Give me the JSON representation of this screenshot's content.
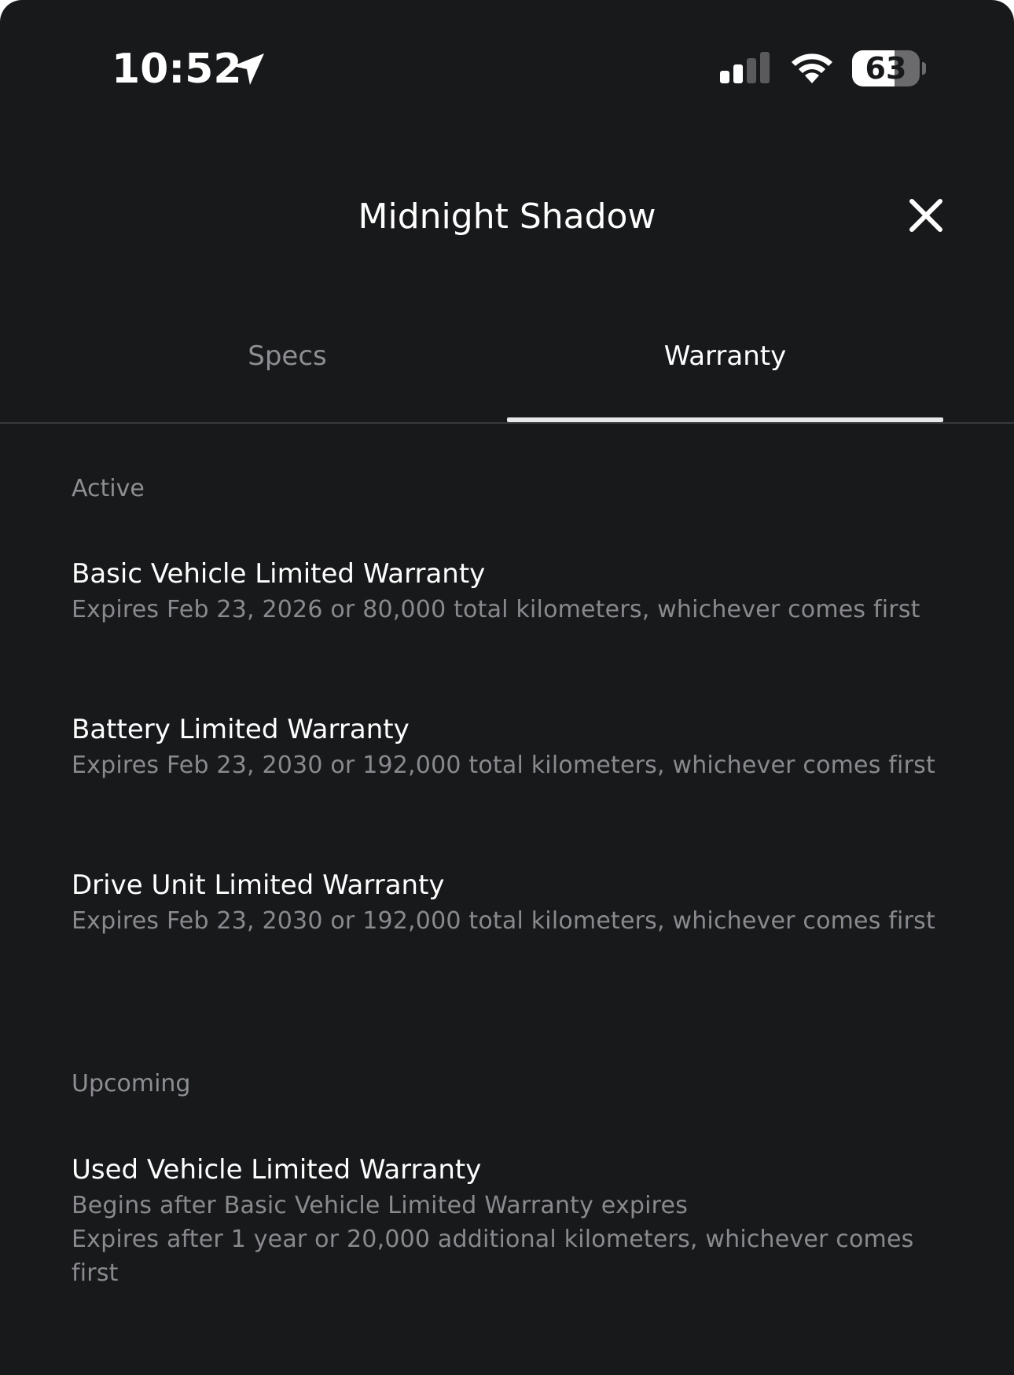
{
  "status_bar": {
    "time": "10:52",
    "battery_level": "63",
    "battery_fraction": 0.63
  },
  "header": {
    "title": "Midnight Shadow",
    "close_icon": "close-icon"
  },
  "tabs": [
    {
      "label": "Specs",
      "selected": false
    },
    {
      "label": "Warranty",
      "selected": true
    }
  ],
  "sections": {
    "active": {
      "label": "Active",
      "items": [
        {
          "name": "Basic Vehicle Limited Warranty",
          "detail": "Expires Feb 23, 2026 or 80,000 total kilometers, whichever comes first"
        },
        {
          "name": "Battery Limited Warranty",
          "detail": "Expires Feb 23, 2030 or 192,000 total kilometers, whichever comes first"
        },
        {
          "name": "Drive Unit Limited Warranty",
          "detail": "Expires Feb 23, 2030 or 192,000 total kilometers, whichever comes first"
        }
      ]
    },
    "upcoming": {
      "label": "Upcoming",
      "items": [
        {
          "name": "Used Vehicle Limited Warranty",
          "detail_begins": "Begins after Basic Vehicle Limited Warranty expires",
          "detail": "Expires after 1 year or 20,000 additional kilometers, whichever comes first"
        }
      ]
    }
  },
  "colors": {
    "background": "#18191b",
    "primary_text": "#ffffff",
    "secondary_text": "#8a8a8e",
    "tab_underline": "#e8e8ea"
  }
}
